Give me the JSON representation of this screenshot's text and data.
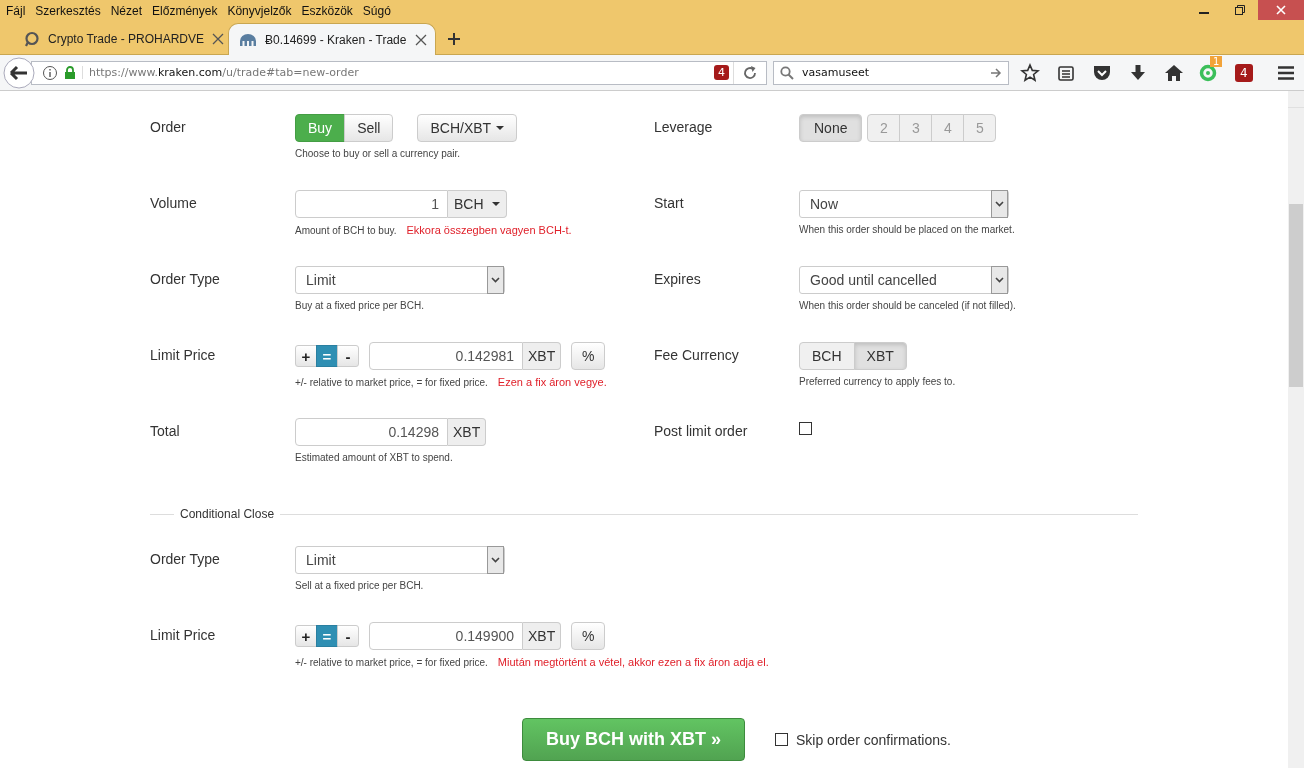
{
  "browser": {
    "menu": [
      "Fájl",
      "Szerkesztés",
      "Nézet",
      "Előzmények",
      "Könyvjelzők",
      "Eszközök",
      "Súgó"
    ],
    "tabs": [
      {
        "title": "Crypto Trade - PROHARDVE",
        "selected": false
      },
      {
        "title": "Ƀ0.14699 - Kraken - Trade",
        "selected": true
      }
    ],
    "address": {
      "url_prefix": "https://www.",
      "url_domain": "kraken.com",
      "url_path": "/u/trade#tab=new-order",
      "badge": "4"
    },
    "search": {
      "value": "vasamuseet"
    },
    "extension_badges": [
      "1",
      "4"
    ]
  },
  "form": {
    "rows": [
      {
        "fields": [
          {
            "kind": "trade-side",
            "label": "Order",
            "options": [
              {
                "label": "Buy",
                "selected": true
              },
              {
                "label": "Sell",
                "selected": false
              }
            ],
            "pair": "BCH/XBT",
            "hint": "Choose to buy or sell a currency pair."
          },
          {
            "kind": "leverage",
            "label": "Leverage",
            "options": [
              {
                "label": "None",
                "selected": true
              },
              {
                "label": "2",
                "selected": false
              },
              {
                "label": "3",
                "selected": false
              },
              {
                "label": "4",
                "selected": false
              },
              {
                "label": "5",
                "selected": false
              }
            ]
          }
        ]
      },
      {
        "fields": [
          {
            "kind": "amount",
            "label": "Volume",
            "value": "1",
            "unit": "BCH",
            "unit_menu": true,
            "hint": "Amount of BCH to buy.",
            "note": "Ekkora összegben vagyen BCH-t."
          },
          {
            "kind": "select",
            "label": "Start",
            "value": "Now",
            "hint": "When this order should be placed on the market."
          }
        ]
      },
      {
        "fields": [
          {
            "kind": "select",
            "label": "Order Type",
            "value": "Limit",
            "hint": "Buy at a fixed price per BCH."
          },
          {
            "kind": "select",
            "label": "Expires",
            "value": "Good until cancelled",
            "hint": "When this order should be canceled (if not filled)."
          }
        ]
      },
      {
        "fields": [
          {
            "kind": "price",
            "label": "Limit Price",
            "modes": [
              {
                "label": "+",
                "selected": false
              },
              {
                "label": "=",
                "selected": true
              },
              {
                "label": "-",
                "selected": false
              }
            ],
            "value": "0.142981",
            "unit": "XBT",
            "percent": "%",
            "hint": "+/- relative to market price, = for fixed price.",
            "note": "Ezen a fix áron vegye."
          },
          {
            "kind": "fee",
            "label": "Fee Currency",
            "options": [
              {
                "label": "BCH",
                "selected": false
              },
              {
                "label": "XBT",
                "selected": true
              }
            ],
            "hint": "Preferred currency to apply fees to."
          }
        ]
      },
      {
        "fields": [
          {
            "kind": "amount",
            "label": "Total",
            "value": "0.14298",
            "unit": "XBT",
            "unit_menu": false,
            "hint": "Estimated amount of XBT to spend."
          },
          {
            "kind": "checkbox",
            "label": "Post limit order",
            "checked": false
          }
        ]
      }
    ],
    "conditional_close": {
      "title": "Conditional Close",
      "rows": [
        {
          "fields": [
            {
              "kind": "select",
              "label": "Order Type",
              "value": "Limit",
              "hint": "Sell at a fixed price per BCH."
            }
          ]
        },
        {
          "fields": [
            {
              "kind": "price",
              "label": "Limit Price",
              "modes": [
                {
                  "label": "+",
                  "selected": false
                },
                {
                  "label": "=",
                  "selected": true
                },
                {
                  "label": "-",
                  "selected": false
                }
              ],
              "value": "0.149900",
              "unit": "XBT",
              "percent": "%",
              "hint": "+/- relative to market price, = for fixed price.",
              "note": "Miután megtörtént a vétel, akkor ezen a fix áron adja el."
            }
          ]
        }
      ]
    },
    "submit": {
      "label": "Buy BCH with XBT »"
    },
    "skip_confirmation": {
      "label": "Skip order confirmations.",
      "checked": false
    }
  }
}
